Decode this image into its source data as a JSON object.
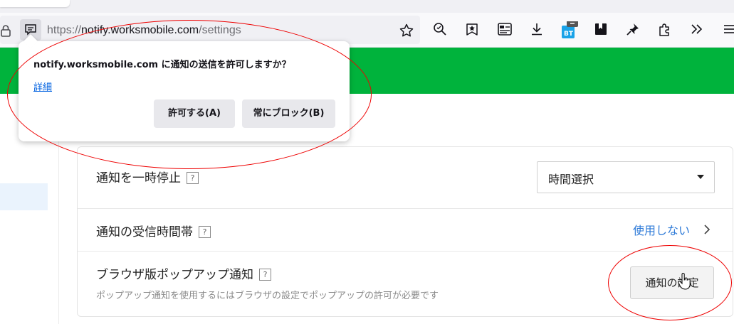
{
  "browser": {
    "url_prefix": "https://",
    "url_host": "notify.worksmobile.com",
    "url_path": "/settings",
    "toolbar_icons": [
      "lock-icon",
      "permission-icon",
      "bookmark-star-icon",
      "zoom-search-icon",
      "saved-pages-icon",
      "reader-icon",
      "download-icon",
      "extension-bt-icon",
      "bookmark-dark-icon",
      "pin-icon",
      "extensions-puzzle-icon",
      "overflow-chevrons-icon",
      "menu-icon"
    ]
  },
  "permission_popup": {
    "message": "notify.worksmobile.com に通知の送信を許可しますか？",
    "details_link": "詳細",
    "allow_button": "許可する(A)",
    "block_button": "常にブロック(B)"
  },
  "settings": {
    "pause": {
      "label": "通知を一時停止",
      "help": "?",
      "select_value": "時間選択"
    },
    "receive_hours": {
      "label": "通知の受信時間帯",
      "help": "?",
      "value": "使用しない"
    },
    "browser_popup": {
      "label": "ブラウザ版ポップアップ通知",
      "help": "?",
      "description": "ポップアップ通知を使用するにはブラウザの設定でポップアップの許可が必要です",
      "button": "通知の設定"
    }
  },
  "colors": {
    "banner": "#00b33c",
    "link": "#2f7bd8",
    "annotation": "#e00000"
  }
}
